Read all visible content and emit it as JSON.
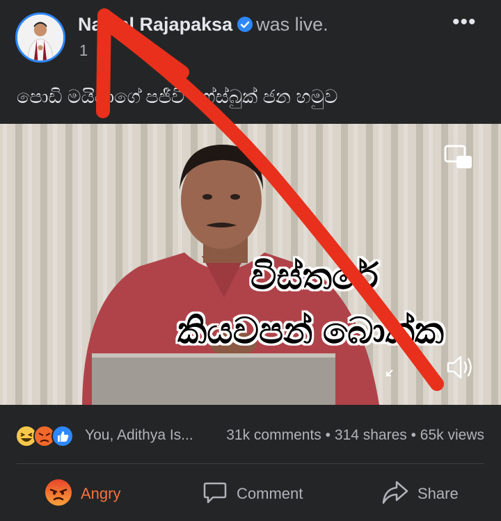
{
  "post": {
    "author": "Namal Rajapaksa",
    "status": "was live.",
    "time": "1",
    "caption": "පොඩි මයියාගේ පජීවී ෆේස්බුක් ජන හමුව",
    "more_label": "•••"
  },
  "video": {
    "overlay_line1": "විස්තරේ",
    "overlay_line2": "කියවපන් බොක්ක"
  },
  "stats": {
    "reactors": "You, Adithya Is...",
    "comments": "31k comments",
    "shares": "314 shares",
    "views": "65k views",
    "separator": "•"
  },
  "actions": {
    "angry": "Angry",
    "comment": "Comment",
    "share": "Share"
  },
  "colors": {
    "background": "#242526",
    "verified": "#2d88ff",
    "angry": "#f7713f",
    "arrow": "#e8301c"
  }
}
